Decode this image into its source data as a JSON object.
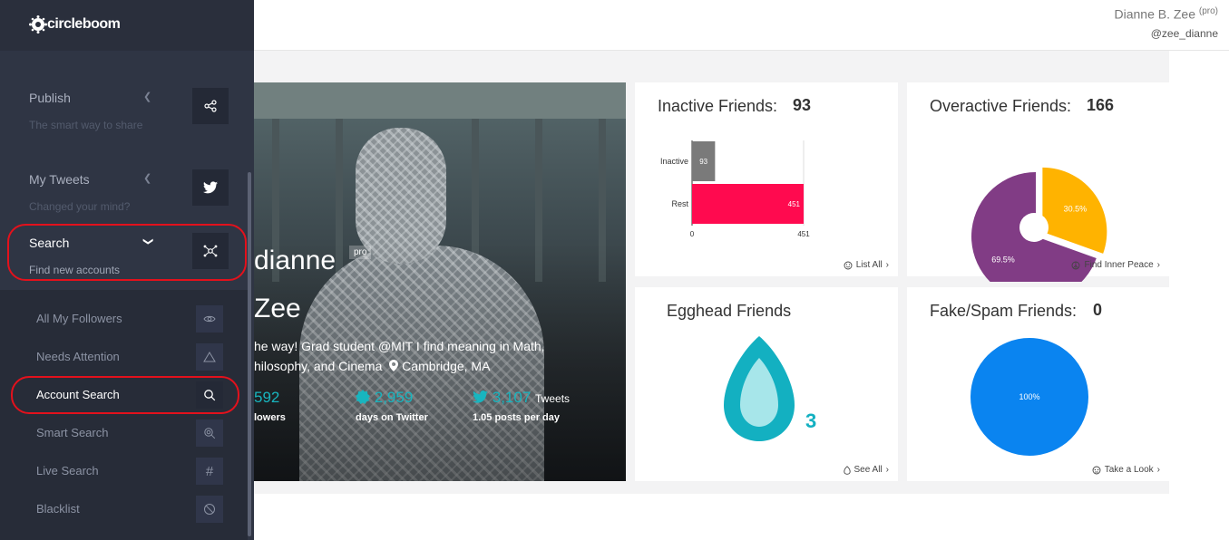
{
  "header": {
    "user_name": "Dianne B. Zee",
    "user_tag": "(pro)",
    "user_handle": "@zee_dianne"
  },
  "sidebar": {
    "logo_text": "circleboom",
    "sections": [
      {
        "title": "Publish",
        "subtitle": "The smart way to share",
        "icon": "share-icon"
      },
      {
        "title": "My Tweets",
        "subtitle": "Changed your mind?",
        "icon": "twitter-bird-icon"
      },
      {
        "title": "Search",
        "subtitle": "Find new accounts",
        "icon": "network-icon"
      }
    ],
    "search_items": [
      {
        "label": "All My Followers",
        "icon": "eye-icon"
      },
      {
        "label": "Needs Attention",
        "icon": "warning-icon"
      },
      {
        "label": "Account Search",
        "icon": "search-icon"
      },
      {
        "label": "Smart Search",
        "icon": "smart-search-icon"
      },
      {
        "label": "Live Search",
        "icon": "hashtag-icon"
      },
      {
        "label": "Blacklist",
        "icon": "block-icon"
      }
    ]
  },
  "profile": {
    "name_line1": "dianne",
    "pro_badge": "pro",
    "name_line2": "Zee",
    "bio_line1": "he way! Grad student @MIT I find meaning in Math,",
    "bio_line2": "hilosophy, and Cinema",
    "location": "Cambridge, MA",
    "followers_value": "592",
    "followers_label": "lowers",
    "days_value": "2,959",
    "days_label": "days on Twitter",
    "tweets_value": "3,107",
    "tweets_word": "Tweets",
    "tweets_label": "1.05 posts per day"
  },
  "cards": {
    "inactive": {
      "title": "Inactive Friends:",
      "count": "93",
      "link": "List All",
      "chart_data": {
        "type": "bar",
        "orientation": "horizontal",
        "categories": [
          "Inactive",
          "Rest"
        ],
        "values": [
          93,
          451
        ],
        "colors": [
          "#7a7a7a",
          "#ff0a4f"
        ],
        "xlim": [
          0,
          451
        ],
        "xticks": [
          "0",
          "451"
        ]
      }
    },
    "overactive": {
      "title": "Overactive Friends:",
      "count": "166",
      "link": "Find Inner Peace",
      "chart_data": {
        "type": "pie",
        "donut": true,
        "values": [
          30.5,
          69.5
        ],
        "labels": [
          "30.5%",
          "69.5%"
        ],
        "colors": [
          "#ffb300",
          "#813c85"
        ]
      }
    },
    "egghead": {
      "title": "Egghead Friends",
      "count": "3",
      "link": "See All"
    },
    "fakespam": {
      "title": "Fake/Spam Friends:",
      "count": "0",
      "link": "Take a Look",
      "chart_data": {
        "type": "pie",
        "values": [
          100
        ],
        "labels": [
          "100%"
        ],
        "colors": [
          "#0a84f0"
        ]
      }
    }
  }
}
